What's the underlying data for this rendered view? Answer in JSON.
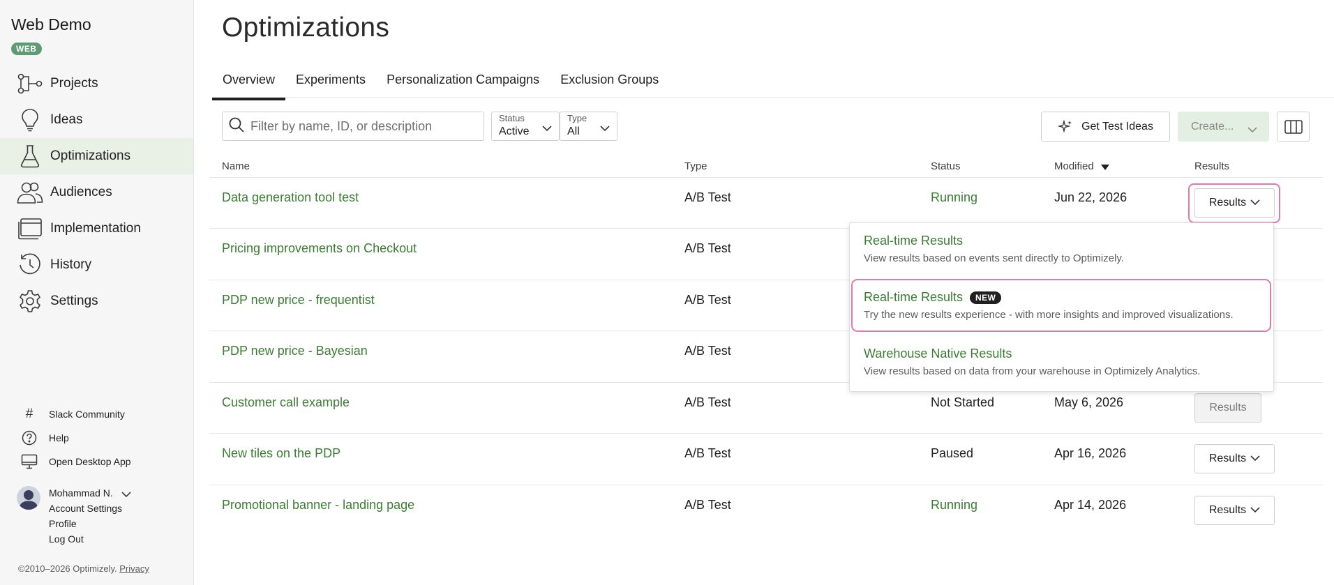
{
  "sidebar": {
    "brand": "Web Demo",
    "badge": "WEB",
    "nav": [
      {
        "label": "Projects",
        "icon": "projects-icon"
      },
      {
        "label": "Ideas",
        "icon": "lightbulb-icon"
      },
      {
        "label": "Optimizations",
        "icon": "flask-icon",
        "active": true
      },
      {
        "label": "Audiences",
        "icon": "users-icon"
      },
      {
        "label": "Implementation",
        "icon": "window-icon"
      },
      {
        "label": "History",
        "icon": "history-icon"
      },
      {
        "label": "Settings",
        "icon": "gear-icon"
      }
    ],
    "utilities": [
      {
        "label": "Slack Community",
        "icon": "hash-icon"
      },
      {
        "label": "Help",
        "icon": "help-icon"
      },
      {
        "label": "Open Desktop App",
        "icon": "desktop-icon"
      }
    ],
    "user": {
      "name": "Mohammad N.",
      "links": [
        "Account Settings",
        "Profile",
        "Log Out"
      ]
    },
    "copyright": "©2010–2026 Optimizely.",
    "privacy": "Privacy"
  },
  "main": {
    "title": "Optimizations",
    "tabs": [
      "Overview",
      "Experiments",
      "Personalization Campaigns",
      "Exclusion Groups"
    ],
    "filter": {
      "placeholder": "Filter by name, ID, or description",
      "status_label": "Status",
      "status_value": "Active",
      "type_label": "Type",
      "type_value": "All"
    },
    "buttons": {
      "get_test_ideas": "Get Test Ideas",
      "create": "Create..."
    },
    "columns": {
      "name": "Name",
      "type": "Type",
      "status": "Status",
      "modified": "Modified",
      "results": "Results"
    },
    "rows": [
      {
        "name": "Data generation tool test",
        "type": "A/B Test",
        "status": "Running",
        "modified": "Jun 22, 2026",
        "results": "Results"
      },
      {
        "name": "Pricing improvements on Checkout",
        "type": "A/B Test",
        "status": "",
        "modified": "",
        "results": ""
      },
      {
        "name": "PDP new price - frequentist",
        "type": "A/B Test",
        "status": "",
        "modified": "",
        "results": ""
      },
      {
        "name": "PDP new price - Bayesian",
        "type": "A/B Test",
        "status": "",
        "modified": "",
        "results": ""
      },
      {
        "name": "Customer call example",
        "type": "A/B Test",
        "status": "Not Started",
        "modified": "May 6, 2026",
        "results": "Results"
      },
      {
        "name": "New tiles on the PDP",
        "type": "A/B Test",
        "status": "Paused",
        "modified": "Apr 16, 2026",
        "results": "Results"
      },
      {
        "name": "Promotional banner - landing page",
        "type": "A/B Test",
        "status": "Running",
        "modified": "Apr 14, 2026",
        "results": "Results"
      }
    ],
    "dropdown": [
      {
        "title": "Real-time Results",
        "desc": "View results based on events sent directly to Optimizely."
      },
      {
        "title": "Real-time Results",
        "badge": "NEW",
        "desc": "Try the new results experience - with more insights and improved visualizations."
      },
      {
        "title": "Warehouse Native Results",
        "desc": "View results based on data from your warehouse in Optimizely Analytics."
      }
    ]
  },
  "colors": {
    "accent_green": "#3a7d32",
    "badge_green": "#5e9b73",
    "active_nav_bg": "#e9f0e6",
    "create_bg": "#e3efe2",
    "highlight_pink": "#e27aa5"
  }
}
